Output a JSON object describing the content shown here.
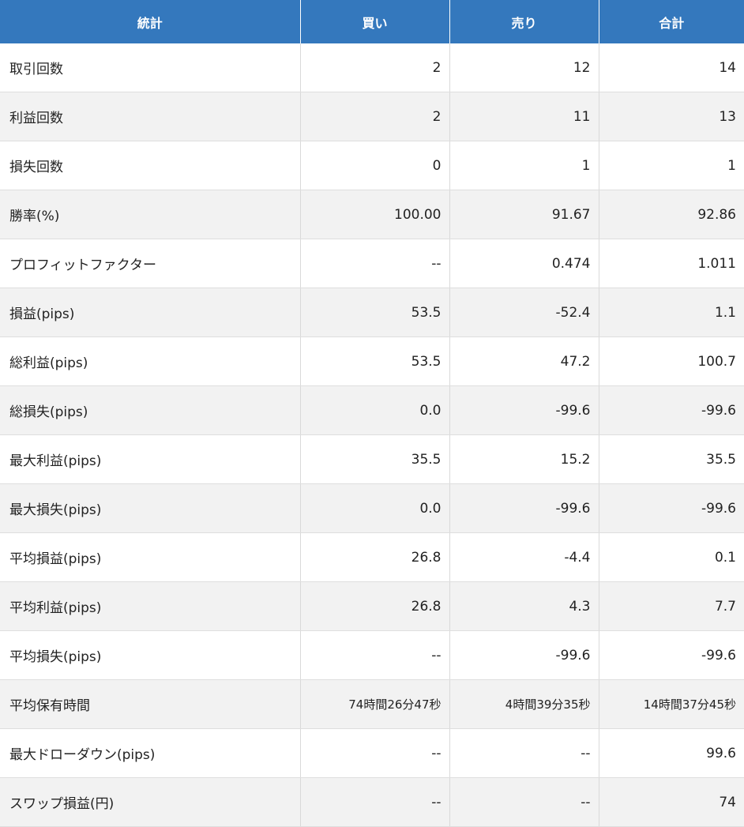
{
  "header": {
    "stat": "統計",
    "buy": "買い",
    "sell": "売り",
    "total": "合計"
  },
  "rows": [
    {
      "label": "取引回数",
      "buy": "2",
      "sell": "12",
      "total": "14"
    },
    {
      "label": "利益回数",
      "buy": "2",
      "sell": "11",
      "total": "13"
    },
    {
      "label": "損失回数",
      "buy": "0",
      "sell": "1",
      "total": "1"
    },
    {
      "label": "勝率(%)",
      "buy": "100.00",
      "sell": "91.67",
      "total": "92.86"
    },
    {
      "label": "プロフィットファクター",
      "buy": "--",
      "sell": "0.474",
      "total": "1.011"
    },
    {
      "label": "損益(pips)",
      "buy": "53.5",
      "sell": "-52.4",
      "total": "1.1"
    },
    {
      "label": "総利益(pips)",
      "buy": "53.5",
      "sell": "47.2",
      "total": "100.7"
    },
    {
      "label": "総損失(pips)",
      "buy": "0.0",
      "sell": "-99.6",
      "total": "-99.6"
    },
    {
      "label": "最大利益(pips)",
      "buy": "35.5",
      "sell": "15.2",
      "total": "35.5"
    },
    {
      "label": "最大損失(pips)",
      "buy": "0.0",
      "sell": "-99.6",
      "total": "-99.6"
    },
    {
      "label": "平均損益(pips)",
      "buy": "26.8",
      "sell": "-4.4",
      "total": "0.1"
    },
    {
      "label": "平均利益(pips)",
      "buy": "26.8",
      "sell": "4.3",
      "total": "7.7"
    },
    {
      "label": "平均損失(pips)",
      "buy": "--",
      "sell": "-99.6",
      "total": "-99.6"
    },
    {
      "label": "平均保有時間",
      "buy": "74時間26分47秒",
      "sell": "4時間39分35秒",
      "total": "14時間37分45秒"
    },
    {
      "label": "最大ドローダウン(pips)",
      "buy": "--",
      "sell": "--",
      "total": "99.6"
    },
    {
      "label": "スワップ損益(円)",
      "buy": "--",
      "sell": "--",
      "total": "74"
    }
  ],
  "colors": {
    "header_bg": "#3478bd",
    "row_alt_bg": "#f2f2f2"
  }
}
